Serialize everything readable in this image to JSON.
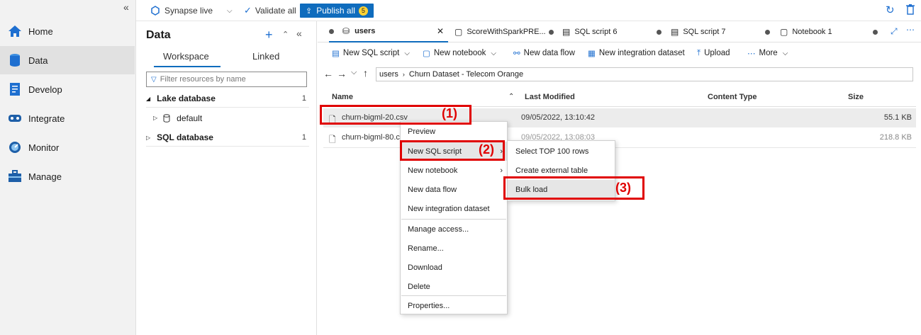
{
  "nav": {
    "items": [
      {
        "label": "Home",
        "icon": "home-icon"
      },
      {
        "label": "Data",
        "icon": "database-icon"
      },
      {
        "label": "Develop",
        "icon": "document-icon"
      },
      {
        "label": "Integrate",
        "icon": "pipeline-icon"
      },
      {
        "label": "Monitor",
        "icon": "gauge-icon"
      },
      {
        "label": "Manage",
        "icon": "toolbox-icon"
      }
    ],
    "collapse_glyph": "«"
  },
  "topbar": {
    "synapse_live": "Synapse live",
    "validate_all": "Validate all",
    "publish_all": "Publish all",
    "publish_count": "5"
  },
  "data_panel": {
    "title": "Data",
    "tabs": [
      "Workspace",
      "Linked"
    ],
    "filter_placeholder": "Filter resources by name",
    "lake_database": "Lake database",
    "lake_count": "1",
    "default_db": "default",
    "sql_database": "SQL database",
    "sql_count": "1"
  },
  "doc_tabs": [
    "users",
    "ScoreWithSparkPRE...",
    "SQL script 6",
    "SQL script 7",
    "Notebook 1"
  ],
  "commands": {
    "new_sql_script": "New SQL script",
    "new_notebook": "New notebook",
    "new_data_flow": "New data flow",
    "new_integration_dataset": "New integration dataset",
    "upload": "Upload",
    "more": "More"
  },
  "breadcrumb": [
    "users",
    "Churn Dataset - Telecom Orange"
  ],
  "table": {
    "headers": [
      "Name",
      "Last Modified",
      "Content Type",
      "Size"
    ],
    "rows": [
      {
        "name": "churn-bigml-20.csv",
        "modified": "09/05/2022, 13:10:42",
        "type": "",
        "size": "55.1 KB"
      },
      {
        "name": "churn-bigml-80.c",
        "modified": "09/05/2022, 13:08:03",
        "type": "",
        "size": "218.8 KB"
      }
    ]
  },
  "context_menu": {
    "items": [
      "Preview",
      "New SQL script",
      "New notebook",
      "New data flow",
      "New integration dataset",
      "Manage access...",
      "Rename...",
      "Download",
      "Delete",
      "Properties..."
    ]
  },
  "submenu": {
    "items": [
      "Select TOP 100 rows",
      "Create external table",
      "Bulk load"
    ]
  },
  "annotations": [
    "(1)",
    "(2)",
    "(3)"
  ],
  "colors": {
    "accent": "#0f6cbd",
    "annotation": "#e00000",
    "badge": "#ffd335"
  }
}
